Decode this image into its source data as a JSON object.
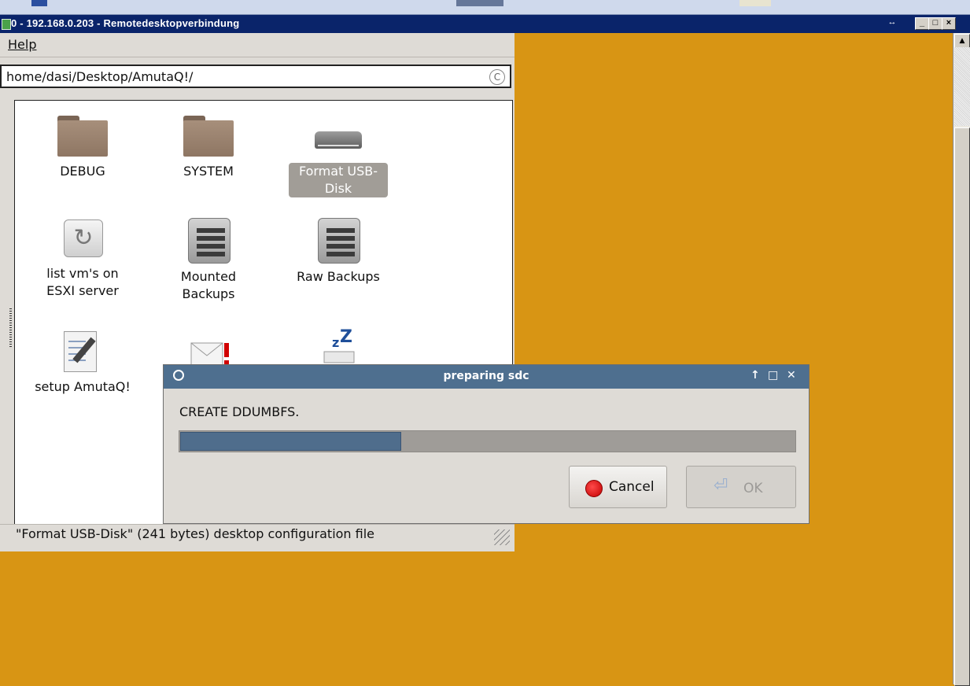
{
  "rdp": {
    "title": "0 - 192.168.0.203 - Remotedesktopverbindung",
    "restore_icon": "↔",
    "minimize_label": "_",
    "maximize_label": "□",
    "close_label": "×",
    "scroll_up": "▲"
  },
  "file_manager": {
    "menu": {
      "help_label": "Help"
    },
    "address": "home/dasi/Desktop/AmutaQ!/",
    "items": [
      {
        "label": "DEBUG",
        "icon": "folder-icon"
      },
      {
        "label": "SYSTEM",
        "icon": "folder-icon"
      },
      {
        "label": "Format USB-Disk",
        "icon": "drive-icon",
        "selected": true
      },
      {
        "label": "list vm's on ESXI server",
        "icon": "refresh-icon"
      },
      {
        "label": "Mounted Backups",
        "icon": "server-icon"
      },
      {
        "label": "Raw Backups",
        "icon": "server-icon"
      },
      {
        "label": "setup AmutaQ!",
        "icon": "notes-icon"
      },
      {
        "label": "",
        "icon": "mail-alert-icon"
      },
      {
        "label": "",
        "icon": "sleep-icon"
      }
    ],
    "status": "\"Format USB-Disk\" (241 bytes) desktop configuration file"
  },
  "dialog": {
    "title": "preparing sdc",
    "controls": {
      "up": "↑",
      "max": "□",
      "close": "✕"
    },
    "message": "CREATE DDUMBFS.",
    "progress": 0.36,
    "cancel_label": "Cancel",
    "ok_label": "OK"
  },
  "colors": {
    "desktop": "#d89514",
    "dialog_title": "#4e6f8f",
    "progress_fill": "#4f6d8c"
  }
}
